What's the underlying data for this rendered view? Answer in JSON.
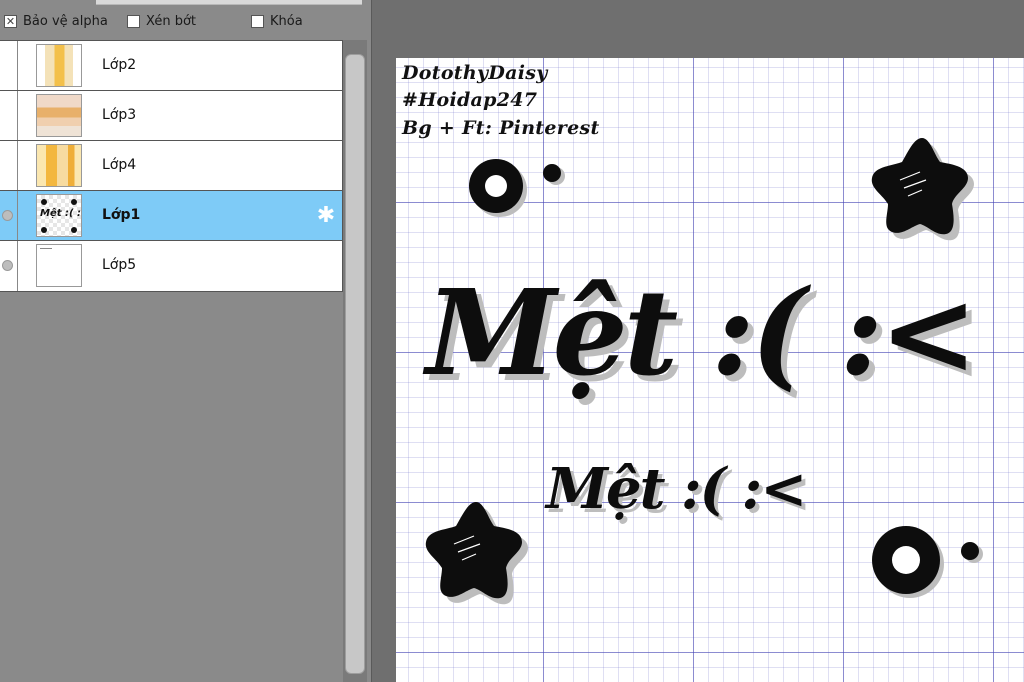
{
  "layer_panel": {
    "options": [
      {
        "label": "Bảo vệ alpha",
        "checked": true
      },
      {
        "label": "Xén bớt",
        "checked": false
      },
      {
        "label": "Khóa",
        "checked": false
      }
    ],
    "layers": [
      {
        "name": "Lớp2",
        "selected": false
      },
      {
        "name": "Lớp3",
        "selected": false
      },
      {
        "name": "Lớp4",
        "selected": false
      },
      {
        "name": "Lớp1",
        "selected": true
      },
      {
        "name": "Lớp5",
        "selected": false
      }
    ],
    "selected_color": "#7ecbf7"
  },
  "canvas": {
    "credits": [
      "DotothyDaisy",
      "#Hoidap247",
      "Bg + Ft: Pinterest"
    ],
    "big_text": "Mệt :( :<",
    "small_text": "Mệt :( :<",
    "thumb_text": "Mệt :( :<",
    "decorations": [
      "ring-icon",
      "star-icon",
      "star-icon",
      "ring-icon"
    ],
    "ink_color": "#0d0d0d",
    "shadow_color": "#bdbdbd"
  }
}
